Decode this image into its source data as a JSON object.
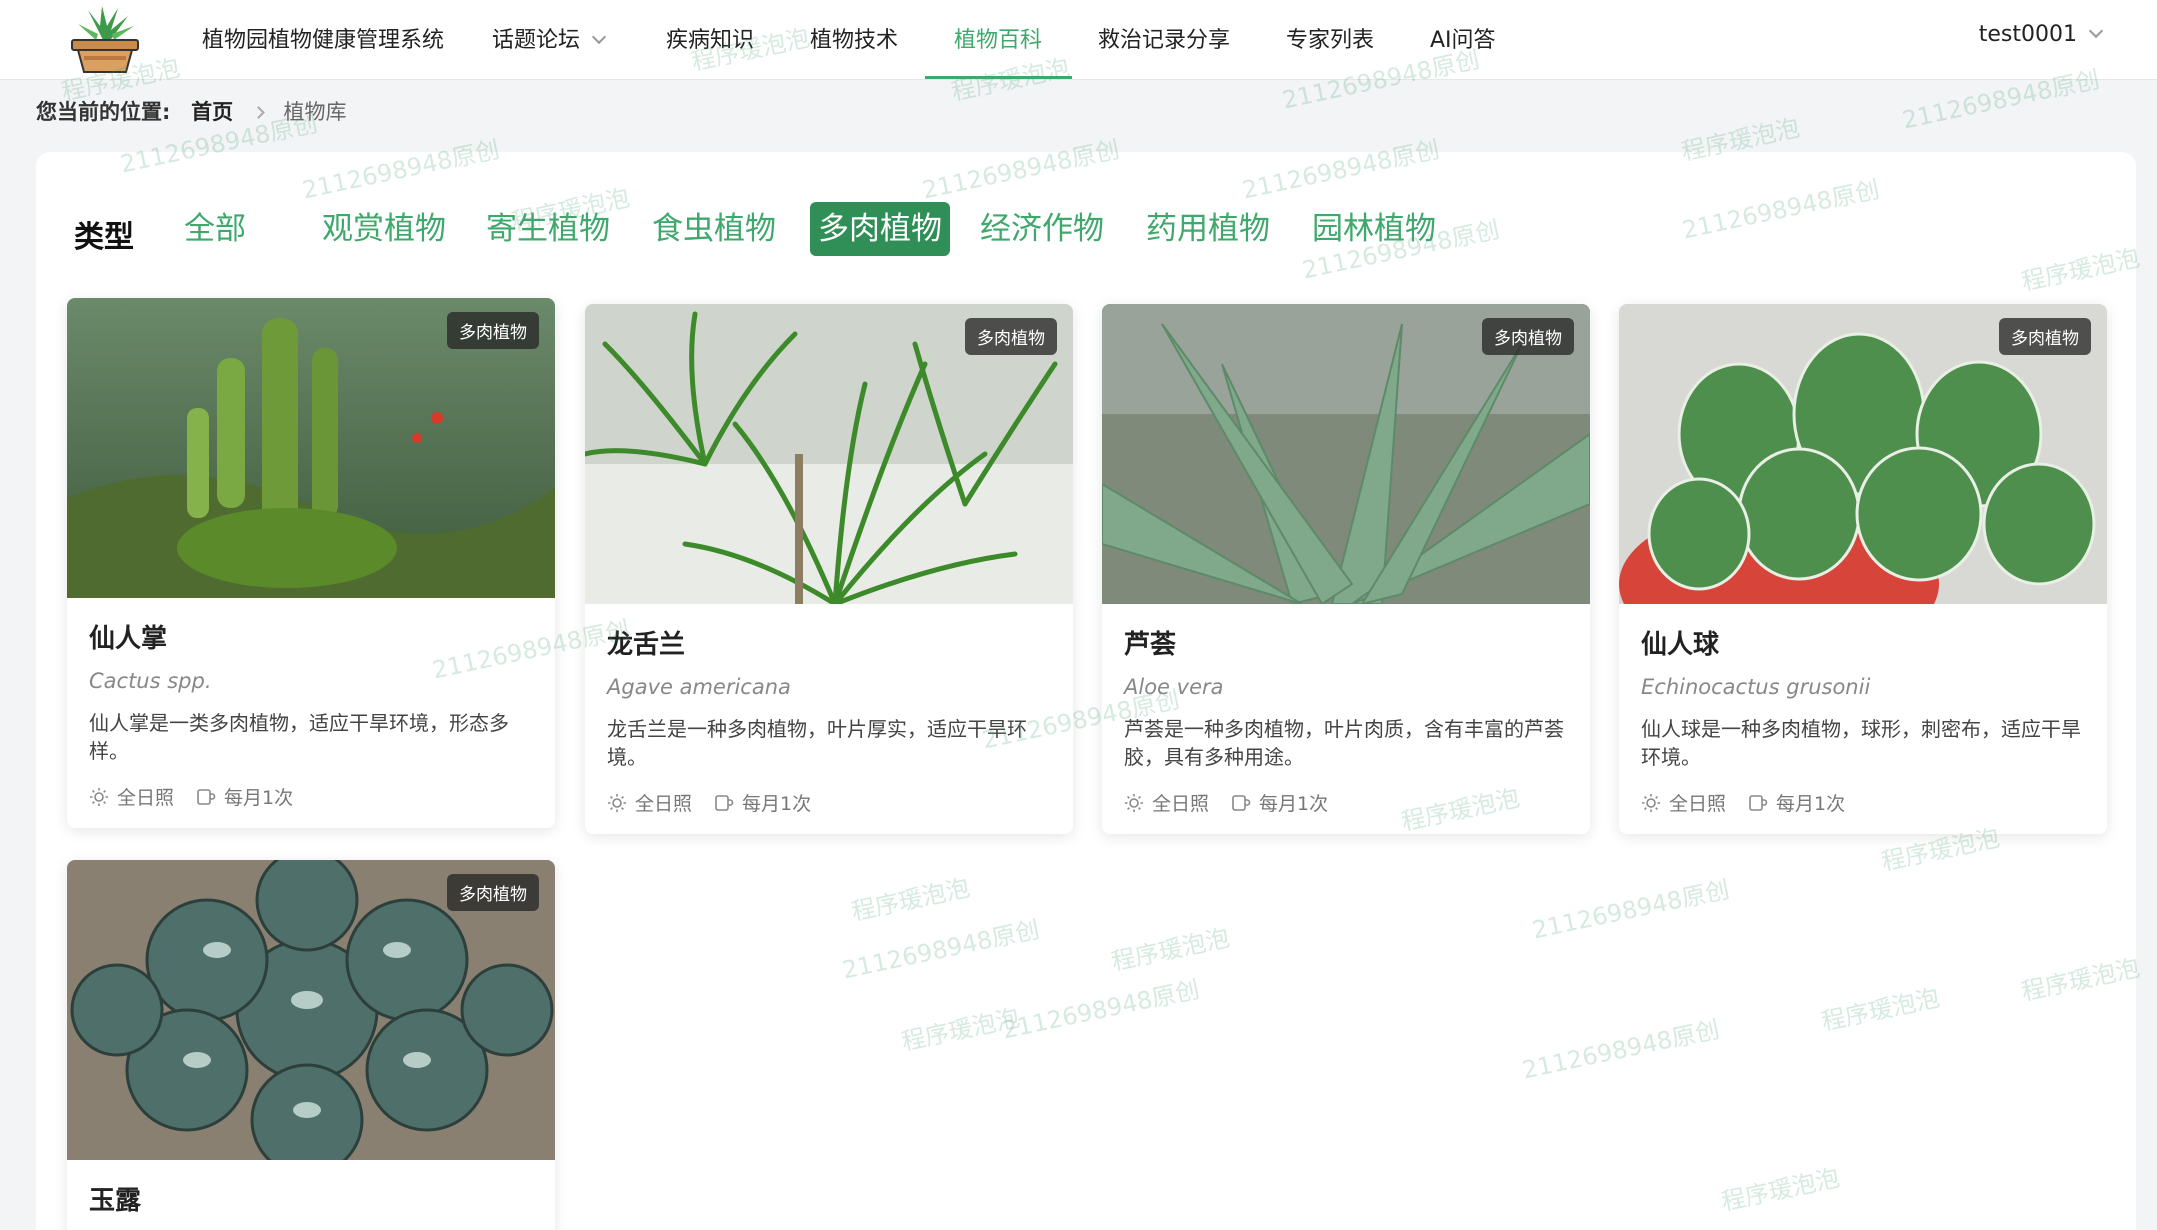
{
  "header": {
    "site_title": "植物园植物健康管理系统",
    "nav": [
      {
        "label": "话题论坛",
        "dropdown": true
      },
      {
        "label": "疾病知识",
        "dropdown": false
      },
      {
        "label": "植物技术",
        "dropdown": false
      },
      {
        "label": "植物百科",
        "dropdown": false,
        "active": true
      },
      {
        "label": "救治记录分享",
        "dropdown": false
      },
      {
        "label": "专家列表",
        "dropdown": false
      },
      {
        "label": "AI问答",
        "dropdown": false
      }
    ],
    "user": "test0001"
  },
  "breadcrumb": {
    "label": "您当前的位置:",
    "home": "首页",
    "current": "植物库"
  },
  "filter": {
    "label": "类型",
    "options": [
      "全部",
      "观赏植物",
      "寄生植物",
      "食虫植物",
      "多肉植物",
      "经济作物",
      "药用植物",
      "园林植物"
    ],
    "active_index": 4
  },
  "cards": [
    {
      "badge": "多肉植物",
      "name": "仙人掌",
      "latin": "Cactus spp.",
      "desc": "仙人掌是一类多肉植物，适应干旱环境，形态多样。",
      "light": "全日照",
      "water": "每月1次"
    },
    {
      "badge": "多肉植物",
      "name": "龙舌兰",
      "latin": "Agave americana",
      "desc": "龙舌兰是一种多肉植物，叶片厚实，适应干旱环境。",
      "light": "全日照",
      "water": "每月1次"
    },
    {
      "badge": "多肉植物",
      "name": "芦荟",
      "latin": "Aloe vera",
      "desc": "芦荟是一种多肉植物，叶片肉质，含有丰富的芦荟胶，具有多种用途。",
      "light": "全日照",
      "water": "每月1次"
    },
    {
      "badge": "多肉植物",
      "name": "仙人球",
      "latin": "Echinocactus grusonii",
      "desc": "仙人球是一种多肉植物，球形，刺密布，适应干旱环境。",
      "light": "全日照",
      "water": "每月1次"
    },
    {
      "badge": "多肉植物",
      "name": "玉露",
      "latin": "",
      "desc": "",
      "light": "",
      "water": ""
    }
  ],
  "watermark": {
    "text_a": "程序瑗泡泡",
    "text_b": "2112698948原创"
  },
  "colors": {
    "accent": "#3fa86c",
    "active_tag_bg": "#2f8f57"
  }
}
